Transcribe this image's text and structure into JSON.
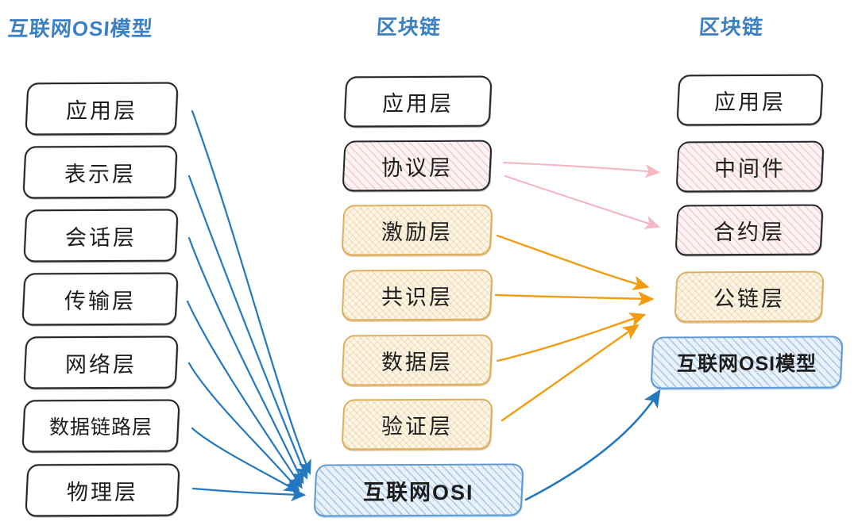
{
  "diagram": {
    "title_internet_osi": "互联网OSI模型",
    "title_blockchain_mid": "区块链",
    "title_blockchain_right": "区块链"
  },
  "colors": {
    "title_blue": "#3c80c4",
    "outline_dark": "#23262b",
    "arrow_blue": "#2378c0",
    "arrow_orange": "#f39c12",
    "arrow_pink": "#f7b7c2",
    "box_orange_border": "#dfae5c",
    "box_blue_border": "#5e9ad2"
  },
  "columns": {
    "left": {
      "title": "互联网OSI模型",
      "layers": [
        {
          "label": "应用层",
          "style": "plain"
        },
        {
          "label": "表示层",
          "style": "plain"
        },
        {
          "label": "会话层",
          "style": "plain"
        },
        {
          "label": "传输层",
          "style": "plain"
        },
        {
          "label": "网络层",
          "style": "plain"
        },
        {
          "label": "数据链路层",
          "style": "plain"
        },
        {
          "label": "物理层",
          "style": "plain"
        }
      ]
    },
    "middle": {
      "title": "区块链",
      "layers": [
        {
          "label": "应用层",
          "style": "plain"
        },
        {
          "label": "协议层",
          "style": "pink"
        },
        {
          "label": "激励层",
          "style": "orange"
        },
        {
          "label": "共识层",
          "style": "orange"
        },
        {
          "label": "数据层",
          "style": "orange"
        },
        {
          "label": "验证层",
          "style": "orange"
        },
        {
          "label": "互联网OSI",
          "style": "blue"
        }
      ]
    },
    "right": {
      "title": "区块链",
      "layers": [
        {
          "label": "应用层",
          "style": "plain"
        },
        {
          "label": "中间件",
          "style": "pink"
        },
        {
          "label": "合约层",
          "style": "pink"
        },
        {
          "label": "公链层",
          "style": "orange"
        },
        {
          "label": "互联网OSI模型",
          "style": "blue"
        }
      ]
    }
  },
  "connections": [
    {
      "from": "应用层",
      "to": "互联网OSI",
      "color": "blue"
    },
    {
      "from": "表示层",
      "to": "互联网OSI",
      "color": "blue"
    },
    {
      "from": "会话层",
      "to": "互联网OSI",
      "color": "blue"
    },
    {
      "from": "传输层",
      "to": "互联网OSI",
      "color": "blue"
    },
    {
      "from": "网络层",
      "to": "互联网OSI",
      "color": "blue"
    },
    {
      "from": "数据链路层",
      "to": "互联网OSI",
      "color": "blue"
    },
    {
      "from": "物理层",
      "to": "互联网OSI",
      "color": "blue"
    },
    {
      "from": "协议层",
      "to": "中间件",
      "color": "pink"
    },
    {
      "from": "协议层",
      "to": "合约层",
      "color": "pink"
    },
    {
      "from": "激励层",
      "to": "公链层",
      "color": "orange"
    },
    {
      "from": "共识层",
      "to": "公链层",
      "color": "orange"
    },
    {
      "from": "数据层",
      "to": "公链层",
      "color": "orange"
    },
    {
      "from": "验证层",
      "to": "公链层",
      "color": "orange"
    },
    {
      "from": "互联网OSI",
      "to": "互联网OSI模型",
      "color": "blue"
    }
  ]
}
